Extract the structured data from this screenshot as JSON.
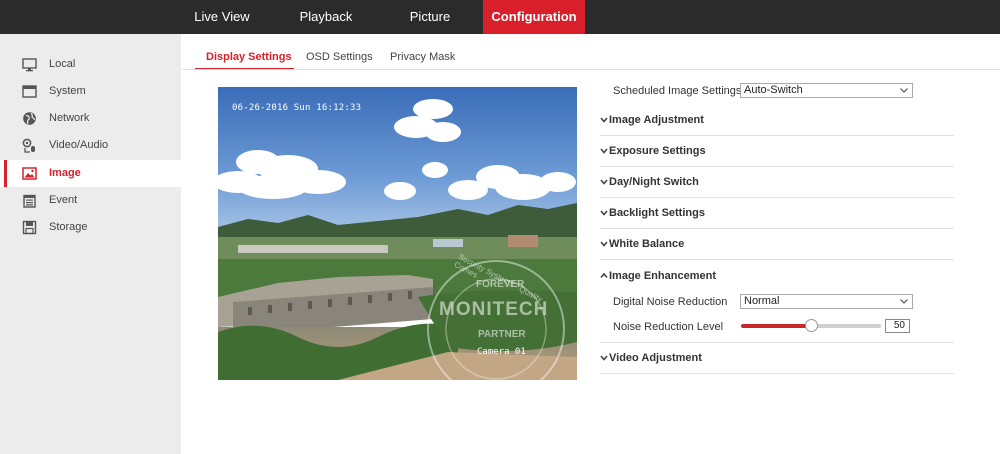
{
  "topnav": {
    "items": [
      {
        "label": "Live View",
        "active": false
      },
      {
        "label": "Playback",
        "active": false
      },
      {
        "label": "Picture",
        "active": false
      },
      {
        "label": "Configuration",
        "active": true
      }
    ]
  },
  "sidebar": {
    "items": [
      {
        "label": "Local",
        "icon": "monitor-icon",
        "active": false
      },
      {
        "label": "System",
        "icon": "window-icon",
        "active": false
      },
      {
        "label": "Network",
        "icon": "globe-icon",
        "active": false
      },
      {
        "label": "Video/Audio",
        "icon": "microphone-icon",
        "active": false
      },
      {
        "label": "Image",
        "icon": "picture-icon",
        "active": true
      },
      {
        "label": "Event",
        "icon": "calendar-icon",
        "active": false
      },
      {
        "label": "Storage",
        "icon": "disk-icon",
        "active": false
      }
    ]
  },
  "tabs": [
    {
      "label": "Display Settings",
      "active": true
    },
    {
      "label": "OSD Settings",
      "active": false
    },
    {
      "label": "Privacy Mask",
      "active": false
    }
  ],
  "preview": {
    "osd_time": "06-26-2016 Sun 16:12:33",
    "camera_name": "Camera 01",
    "watermark": {
      "brand": "MONITECH",
      "top": "FOREVER",
      "bottom": "PARTNER",
      "ring": "Security Systems · Quality Comes"
    }
  },
  "settings": {
    "scheduled_label": "Scheduled Image Settings",
    "scheduled_value": "Auto-Switch",
    "sections": [
      {
        "title": "Image Adjustment",
        "expanded": false
      },
      {
        "title": "Exposure Settings",
        "expanded": false
      },
      {
        "title": "Day/Night Switch",
        "expanded": false
      },
      {
        "title": "Backlight Settings",
        "expanded": false
      },
      {
        "title": "White Balance",
        "expanded": false
      },
      {
        "title": "Image Enhancement",
        "expanded": true
      },
      {
        "title": "Video Adjustment",
        "expanded": false
      }
    ],
    "dnr_label": "Digital Noise Reduction",
    "dnr_value": "Normal",
    "nr_level_label": "Noise Reduction Level",
    "nr_level_value": "50",
    "nr_level_fraction": 0.5
  },
  "colors": {
    "accent": "#d9202a",
    "topbar": "#2b2b2b",
    "sidebar": "#ececec"
  }
}
